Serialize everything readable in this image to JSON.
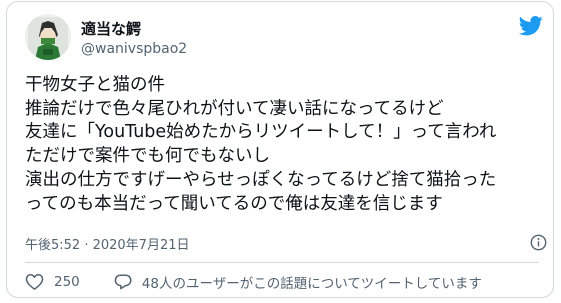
{
  "author": {
    "display_name": "適当な鰐",
    "handle": "@wanivspbao2"
  },
  "tweet": {
    "lines": [
      "干物女子と猫の件",
      "推論だけで色々尾ひれが付いて凄い話になってるけど",
      "友達に「YouTube始めたからリツイートして！」って言われ",
      "ただけで案件でも何でもないし",
      "演出の仕方ですげーやらせっぽくなってるけど捨て猫拾った",
      "ってのも本当だって聞いてるので俺は友達を信じます"
    ],
    "timestamp": "午後5:52 · 2020年7月21日"
  },
  "footer": {
    "likes": "250",
    "discussion": "48人のユーザーがこの話題についてツイートしています"
  },
  "colors": {
    "brand": "#1d9bf0",
    "text": "#0f1419",
    "secondary": "#536471"
  },
  "icons": {
    "brand": "twitter-bird-icon",
    "info": "info-icon",
    "like": "heart-icon",
    "reply": "reply-bubble-icon"
  }
}
